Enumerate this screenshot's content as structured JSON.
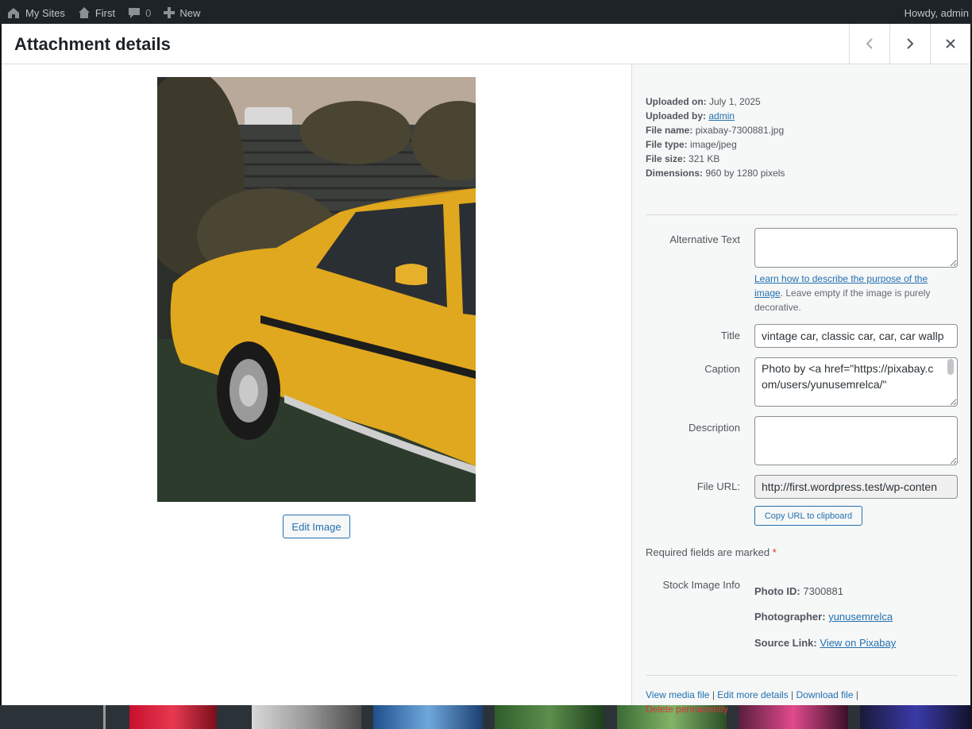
{
  "adminbar": {
    "my_sites": "My Sites",
    "site": "First",
    "comments": "0",
    "new": "New",
    "howdy": "Howdy, admin"
  },
  "modal": {
    "title": "Attachment details",
    "edit_image": "Edit Image"
  },
  "meta": {
    "uploaded_on_label": "Uploaded on:",
    "uploaded_on": "July 1, 2025",
    "uploaded_by_label": "Uploaded by:",
    "uploaded_by": "admin",
    "file_name_label": "File name:",
    "file_name": "pixabay-7300881.jpg",
    "file_type_label": "File type:",
    "file_type": "image/jpeg",
    "file_size_label": "File size:",
    "file_size": "321 KB",
    "dimensions_label": "Dimensions:",
    "dimensions": "960 by 1280 pixels"
  },
  "fields": {
    "alt_label": "Alternative Text",
    "alt_value": "",
    "alt_help_link": "Learn how to describe the purpose of the image",
    "alt_help_rest": ". Leave empty if the image is purely decorative.",
    "title_label": "Title",
    "title_value": "vintage car, classic car, car, car wallp",
    "caption_label": "Caption",
    "caption_value": "Photo by <a href=\"https://pixabay.com/users/yunusemrelca/\"",
    "description_label": "Description",
    "description_value": "",
    "file_url_label": "File URL:",
    "file_url_value": "http://first.wordpress.test/wp-conten",
    "copy_url": "Copy URL to clipboard"
  },
  "required": {
    "text": "Required fields are marked",
    "star": "*"
  },
  "stock": {
    "label": "Stock Image Info",
    "photo_id_label": "Photo ID:",
    "photo_id": "7300881",
    "photographer_label": "Photographer:",
    "photographer": "yunusemrelca",
    "source_label": "Source Link:",
    "source": "View on Pixabay"
  },
  "actions": {
    "view": "View media file",
    "edit": "Edit more details",
    "download": "Download file",
    "sep": "|",
    "delete": "Delete permanently"
  },
  "colors": {
    "accent": "#2271b1",
    "danger": "#d63638",
    "car_yellow": "#e0a81e"
  }
}
